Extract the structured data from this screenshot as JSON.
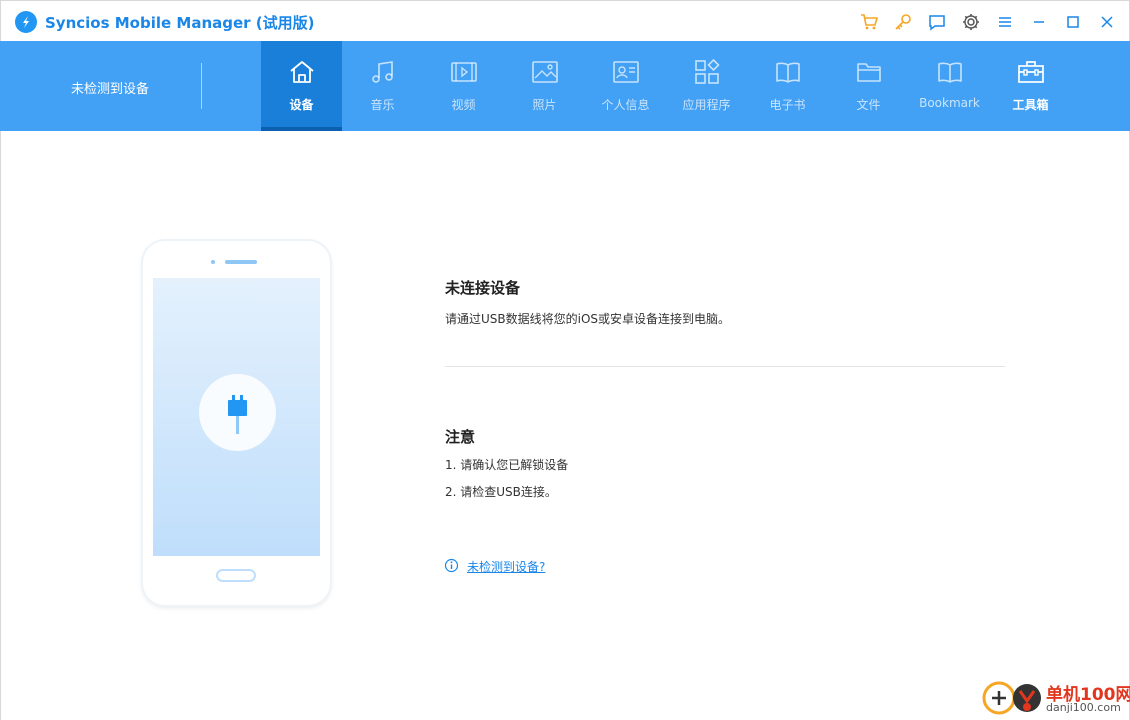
{
  "window": {
    "title": "Syncios Mobile Manager (试用版)"
  },
  "titlebar": {
    "icons": [
      "cart-icon",
      "key-icon",
      "feedback-icon",
      "gear-icon",
      "menu-icon",
      "minimize-icon",
      "maximize-icon",
      "close-icon"
    ]
  },
  "nav": {
    "device_status": "未检测到设备",
    "tabs": [
      {
        "label": "设备",
        "icon": "home-icon",
        "state": "active"
      },
      {
        "label": "音乐",
        "icon": "music-note-icon"
      },
      {
        "label": "视频",
        "icon": "video-icon"
      },
      {
        "label": "照片",
        "icon": "photo-icon"
      },
      {
        "label": "个人信息",
        "icon": "contact-card-icon"
      },
      {
        "label": "应用程序",
        "icon": "apps-grid-icon"
      },
      {
        "label": "电子书",
        "icon": "book-icon"
      },
      {
        "label": "文件",
        "icon": "folder-icon"
      },
      {
        "label": "Bookmark",
        "icon": "bookmark-book-icon"
      },
      {
        "label": "工具箱",
        "icon": "toolbox-icon"
      }
    ]
  },
  "main": {
    "heading": "未连接设备",
    "description": "请通过USB数据线将您的iOS或安卓设备连接到电脑。",
    "note_title": "注意",
    "notes": [
      "1. 请确认您已解锁设备",
      "2. 请检查USB连接。"
    ],
    "help_link": "未检测到设备?"
  },
  "watermark": {
    "name": "单机100网",
    "url": "danji100.com"
  },
  "colors": {
    "accent": "#42a0f5",
    "active_tab": "#1a7fd9",
    "link": "#1a86e8",
    "title": "#1a86e8",
    "toolbar_orange": "#f5a623"
  }
}
